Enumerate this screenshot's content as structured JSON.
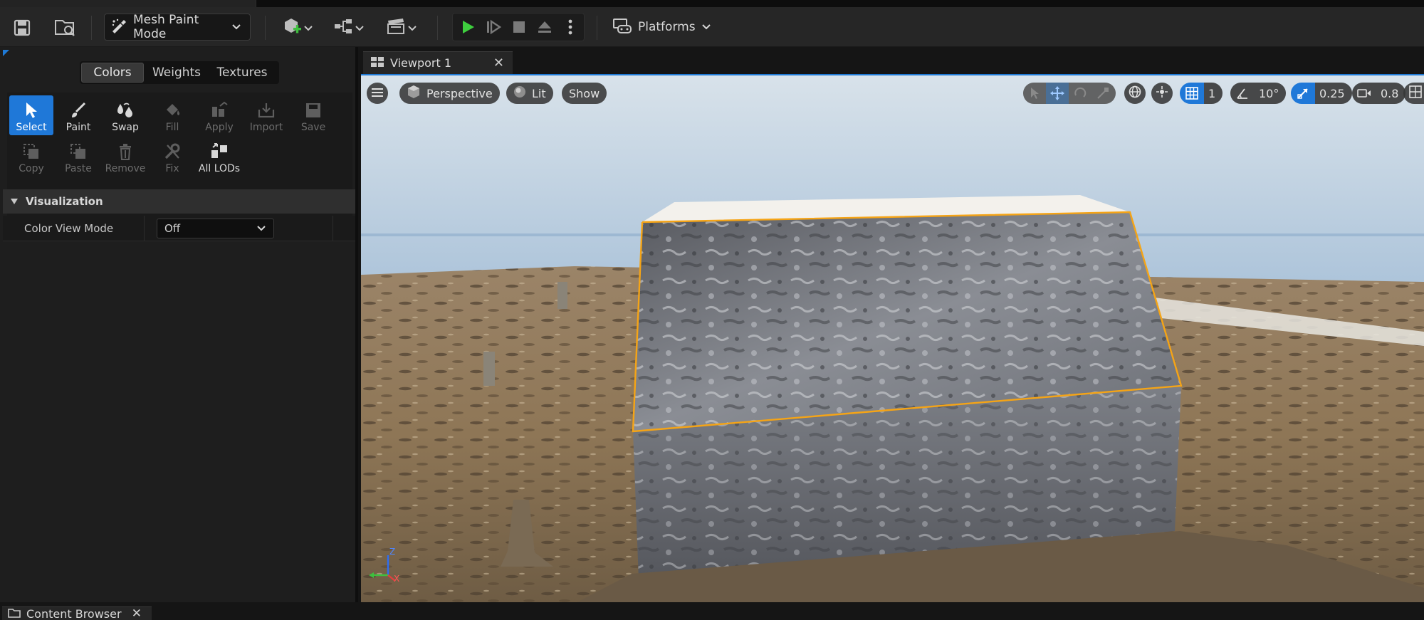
{
  "toolbar": {
    "mode_label": "Mesh Paint Mode",
    "platforms_label": "Platforms",
    "icons": [
      "save-icon",
      "content-browse-icon",
      "paint-mode-icon",
      "add-actor-icon",
      "blueprint-icon",
      "cinematics-icon",
      "play-icon",
      "step-icon",
      "stop-icon",
      "eject-icon",
      "more-icon",
      "platforms-icon"
    ]
  },
  "paint_panel": {
    "tabs": [
      {
        "label": "Colors",
        "active": true
      },
      {
        "label": "Weights",
        "active": false
      },
      {
        "label": "Textures",
        "active": false
      }
    ],
    "tools_row1": [
      {
        "label": "Select",
        "icon": "cursor-icon",
        "enabled": true,
        "selected": true
      },
      {
        "label": "Paint",
        "icon": "brush-icon",
        "enabled": true,
        "selected": false
      },
      {
        "label": "Swap",
        "icon": "swap-icon",
        "enabled": true,
        "selected": false
      },
      {
        "label": "Fill",
        "icon": "fill-bucket-icon",
        "enabled": false,
        "selected": false
      },
      {
        "label": "Apply",
        "icon": "apply-icon",
        "enabled": false,
        "selected": false
      },
      {
        "label": "Import",
        "icon": "import-icon",
        "enabled": false,
        "selected": false
      },
      {
        "label": "Save",
        "icon": "save-icon",
        "enabled": false,
        "selected": false
      }
    ],
    "tools_row2": [
      {
        "label": "Copy",
        "icon": "copy-icon",
        "enabled": false
      },
      {
        "label": "Paste",
        "icon": "paste-icon",
        "enabled": false
      },
      {
        "label": "Remove",
        "icon": "trash-icon",
        "enabled": false
      },
      {
        "label": "Fix",
        "icon": "wrench-icon",
        "enabled": false
      },
      {
        "label": "All LODs",
        "icon": "lods-icon",
        "enabled": true
      }
    ],
    "section_title": "Visualization",
    "property": {
      "name": "Color View Mode",
      "value": "Off"
    }
  },
  "viewport": {
    "tab_label": "Viewport 1",
    "view_type": "Perspective",
    "lighting": "Lit",
    "show_label": "Show",
    "grid_snap": "1",
    "rotation_snap": "10°",
    "scale_snap": "0.25",
    "camera_speed": "0.8",
    "axes": {
      "z": "Z",
      "x": "X"
    }
  },
  "bottom": {
    "content_browser_label": "Content Browser"
  }
}
